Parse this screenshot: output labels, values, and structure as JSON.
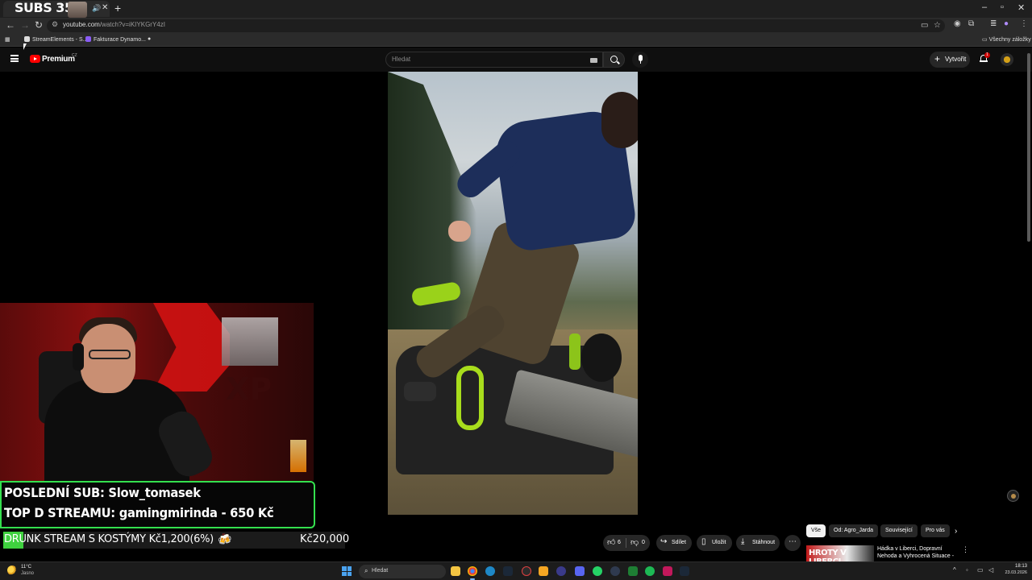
{
  "browser": {
    "tab_title": "SUBS 353/",
    "url_host": "youtube.com",
    "url_path": "/watch?v=iKIYKGrY4zI",
    "bookmarks": [
      "StreamElements - S...",
      "Fakturace Dynamo..."
    ],
    "all_bookmarks": "Všechny záložky"
  },
  "youtube": {
    "brand": "Premium",
    "country": "CZ",
    "search_placeholder": "Hledat",
    "create_label": "Vytvořit",
    "notifications": "1",
    "likes": "6",
    "dislikes": "0",
    "share": "Sdílet",
    "save": "Uložit",
    "download": "Stáhnout",
    "chips": [
      "Vše",
      "Od: Agro_Jarda",
      "Související",
      "Pro vás"
    ],
    "rec_thumb_text": "HROTY V LIBERCI",
    "rec_title": "Hádka v Liberci, Dopravní Nehoda a Vyhrocená Situace - ..."
  },
  "overlay": {
    "last_sub": "POSLEDNÍ SUB: Slow_tomasek",
    "top_donor": "TOP D STREAMU: gamingmirinda - 650 Kč",
    "goal_label": "DRUNK STREAM S KOSTÝMY Kč1,200(6%)",
    "goal_target": "Kč20,000",
    "goal_progress": 0.06,
    "goal_emoji": "🍻"
  },
  "taskbar": {
    "weather_temp": "11°C",
    "weather_desc": "Jasno",
    "search": "Hledat",
    "time": "18:13",
    "date": "23.03.2026"
  },
  "colors": {
    "accent_green": "#34e04e",
    "youtube_red": "#ff0000",
    "goal_fill": "#3fd13f"
  }
}
